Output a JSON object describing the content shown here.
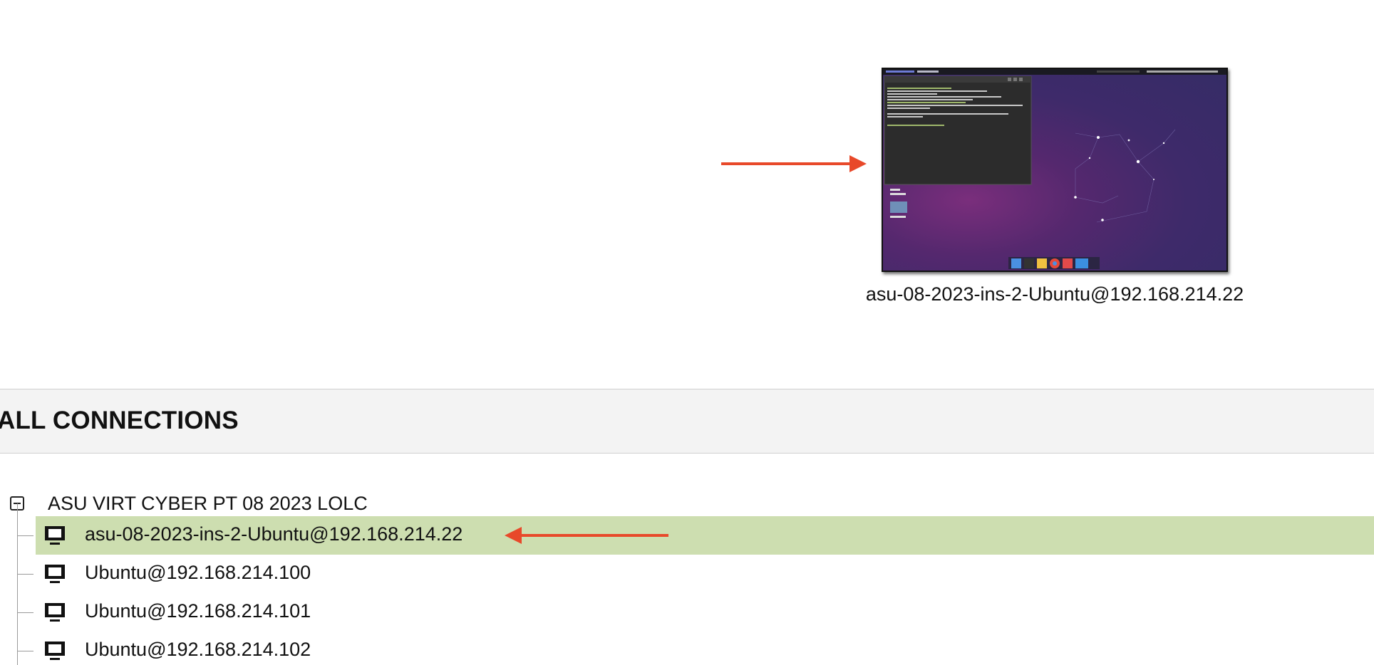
{
  "recent": {
    "thumbnail_label": "asu-08-2023-ins-2-Ubuntu@192.168.214.22"
  },
  "section": {
    "title": "ALL CONNECTIONS"
  },
  "tree": {
    "group": {
      "label": "ASU VIRT CYBER PT 08 2023 LOLC",
      "expanded": true
    },
    "connections": [
      {
        "label": "asu-08-2023-ins-2-Ubuntu@192.168.214.22",
        "selected": true
      },
      {
        "label": "Ubuntu@192.168.214.100",
        "selected": false
      },
      {
        "label": "Ubuntu@192.168.214.101",
        "selected": false
      },
      {
        "label": "Ubuntu@192.168.214.102",
        "selected": false
      }
    ]
  },
  "colors": {
    "arrow": "#e8492a",
    "selected_row": "#cddeb0",
    "header_bg": "#f3f3f3"
  },
  "icons": {
    "connection": "desktop-monitor-icon",
    "group_toggle": "collapse-minus-icon",
    "annotation": "red-arrow"
  }
}
